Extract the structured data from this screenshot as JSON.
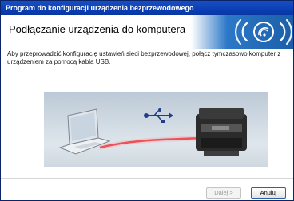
{
  "window": {
    "title": "Program do konfiguracji urządzenia bezprzewodowego"
  },
  "header": {
    "title": "Podłączanie urządzenia do komputera",
    "badge_icon": "wifi-signal-icon"
  },
  "main": {
    "instruction": "Aby przeprowadzić konfigurację ustawień sieci bezprzewodowej, połącz tymczasowo komputer z urządzeniem za pomocą kabla USB.",
    "illustration": {
      "left_icon": "laptop-icon",
      "center_icon": "usb-icon",
      "right_icon": "printer-icon"
    }
  },
  "footer": {
    "next_label": "Dalej >",
    "cancel_label": "Anuluj",
    "next_enabled": false
  },
  "colors": {
    "titlebar": "#0a3fb6",
    "cable": "#e8202a",
    "badge": "#1a5ea8"
  }
}
